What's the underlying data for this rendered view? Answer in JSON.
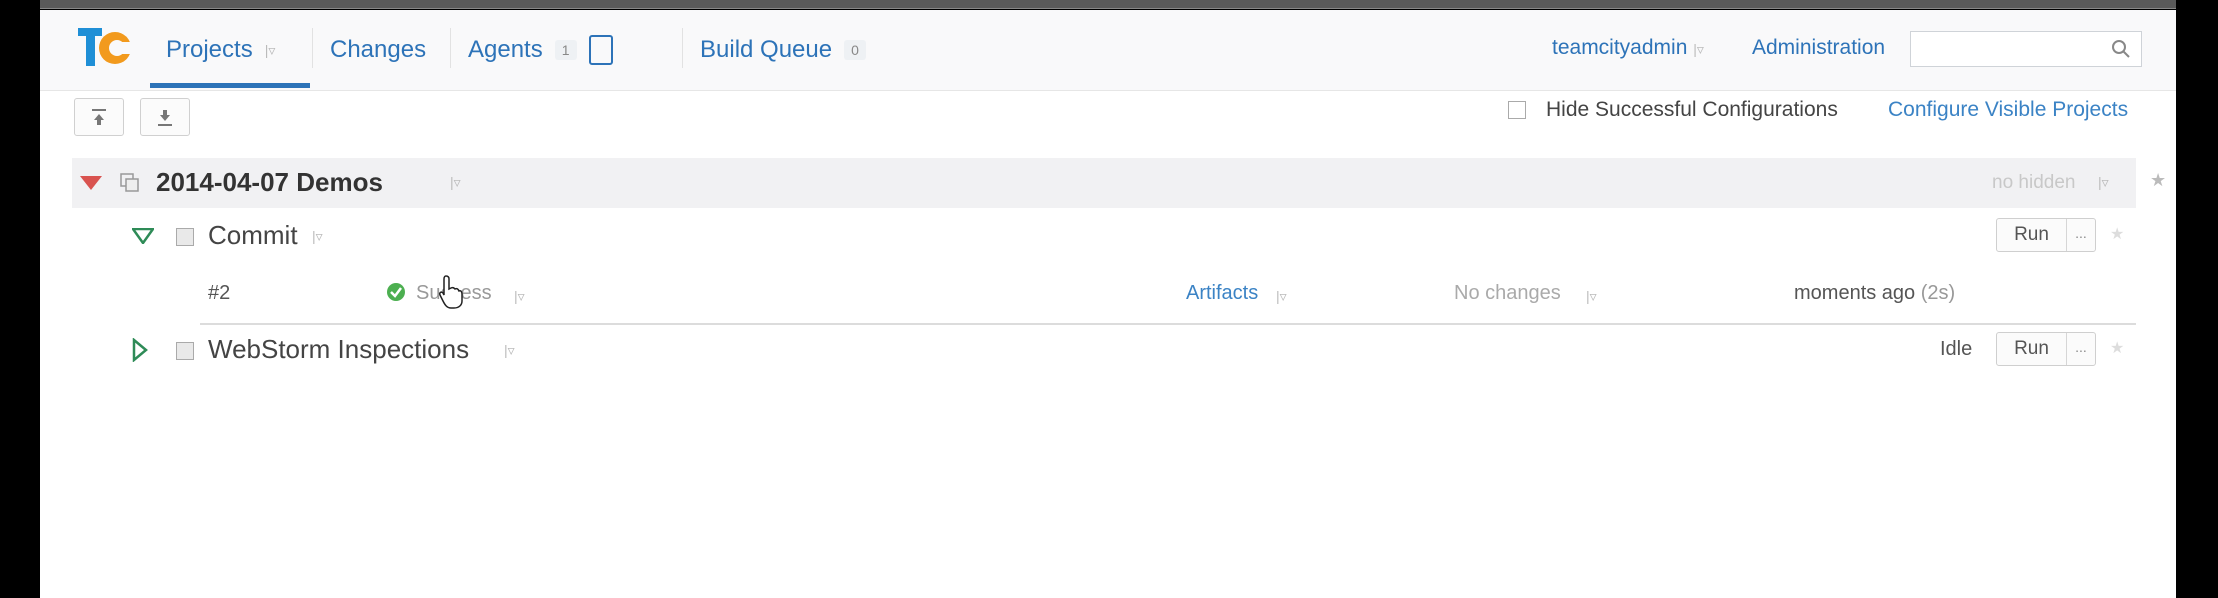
{
  "nav": {
    "projects": "Projects",
    "changes": "Changes",
    "agents": "Agents",
    "agents_count": "1",
    "build_queue": "Build Queue",
    "build_queue_count": "0",
    "user": "teamcityadmin",
    "administration": "Administration"
  },
  "toolbar": {
    "hide_successful": "Hide Successful Configurations",
    "configure_visible": "Configure Visible Projects"
  },
  "project": {
    "name": "2014-04-07 Demos",
    "hidden_note": "no hidden"
  },
  "configs": [
    {
      "name": "Commit",
      "run": "Run",
      "more": "...",
      "build": {
        "number": "#2",
        "status": "Success",
        "artifacts": "Artifacts",
        "changes": "No changes",
        "time": "moments ago",
        "duration": "(2s)"
      }
    },
    {
      "name": "WebStorm Inspections",
      "state": "Idle",
      "run": "Run",
      "more": "..."
    }
  ],
  "colors": {
    "link": "#2d73b8",
    "success": "#4caf50",
    "collapse_triangle": "#d9534f",
    "expand_triangle": "#2e8b57"
  },
  "icons": [
    "teamcity-logo",
    "search-icon",
    "collapse-all-icon",
    "expand-all-icon",
    "checkmark-icon",
    "cursor-hand-icon"
  ]
}
